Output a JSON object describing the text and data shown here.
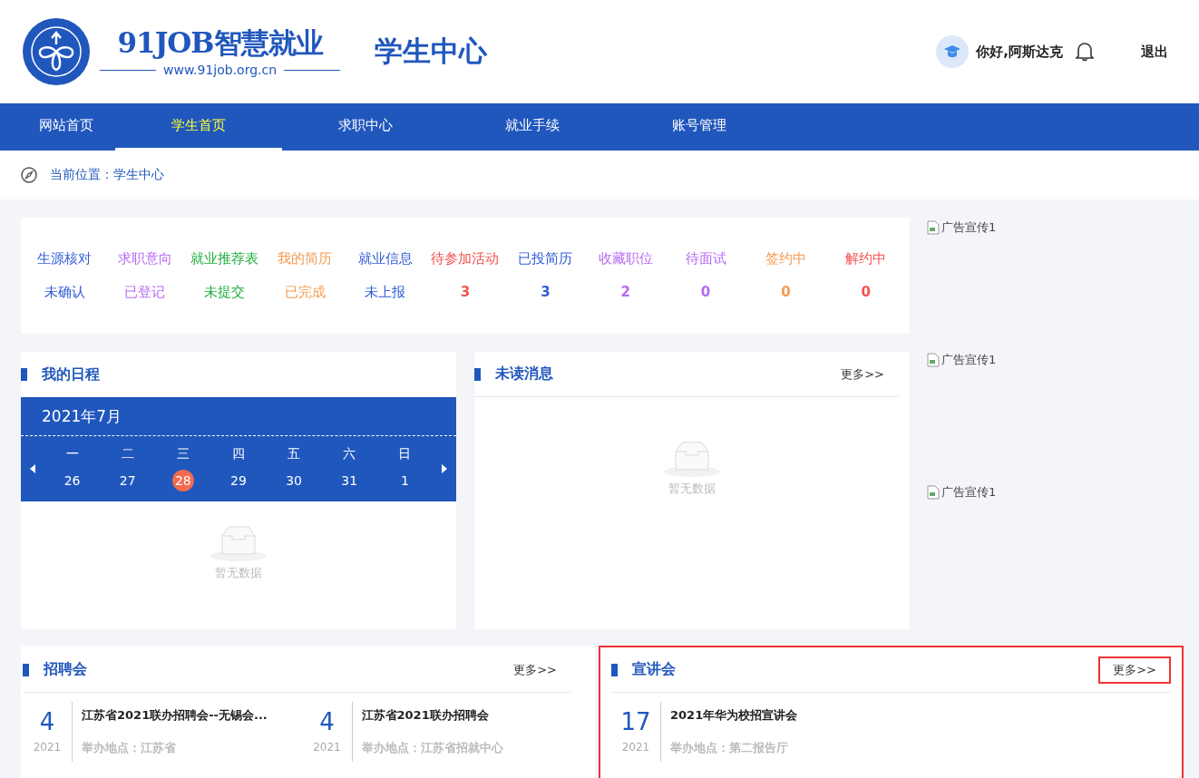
{
  "header": {
    "logo_title": "91JOB智慧就业",
    "logo_url": "www.91job.org.cn",
    "page_title": "学生中心",
    "greeting": "你好,阿斯达克",
    "logout": "退出"
  },
  "nav": [
    {
      "label": "网站首页",
      "selected": false
    },
    {
      "label": "学生首页",
      "selected": true
    },
    {
      "label": "求职中心",
      "selected": false
    },
    {
      "label": "就业手续",
      "selected": false
    },
    {
      "label": "账号管理",
      "selected": false
    }
  ],
  "breadcrumb": "当前位置：学生中心",
  "stats": [
    {
      "label": "生源核对",
      "value": "未确认",
      "color": "#2f5bd6"
    },
    {
      "label": "求职意向",
      "value": "已登记",
      "color": "#b769f2"
    },
    {
      "label": "就业推荐表",
      "value": "未提交",
      "color": "#1fae3c"
    },
    {
      "label": "我的简历",
      "value": "已完成",
      "color": "#f59a4f"
    },
    {
      "label": "就业信息",
      "value": "未上报",
      "color": "#2f5bd6"
    },
    {
      "label": "待参加活动",
      "value": "3",
      "color": "#f2524f"
    },
    {
      "label": "已投简历",
      "value": "3",
      "color": "#2f5bd6"
    },
    {
      "label": "收藏职位",
      "value": "2",
      "color": "#b769f2"
    },
    {
      "label": "待面试",
      "value": "0",
      "color": "#b769f2"
    },
    {
      "label": "签约中",
      "value": "0",
      "color": "#f59a4f"
    },
    {
      "label": "解约中",
      "value": "0",
      "color": "#f2524f"
    }
  ],
  "schedule": {
    "title": "我的日程",
    "month": "2021年7月",
    "weekdays": [
      "一",
      "二",
      "三",
      "四",
      "五",
      "六",
      "日"
    ],
    "days": [
      {
        "label": "26",
        "selected": false
      },
      {
        "label": "27",
        "selected": false
      },
      {
        "label": "28",
        "selected": true
      },
      {
        "label": "29",
        "selected": false
      },
      {
        "label": "30",
        "selected": false
      },
      {
        "label": "31",
        "selected": false
      },
      {
        "label": "1",
        "selected": false
      }
    ],
    "empty": "暂无数据"
  },
  "messages": {
    "title": "未读消息",
    "more": "更多>>",
    "empty": "暂无数据"
  },
  "ads": [
    {
      "alt": "广告宣传1"
    },
    {
      "alt": "广告宣传1"
    },
    {
      "alt": "广告宣传1"
    }
  ],
  "fairs": {
    "title": "招聘会",
    "more": "更多>>",
    "highlighted": false,
    "more_highlighted": false,
    "items": [
      {
        "day": "4",
        "year": "2021",
        "title": "江苏省2021联办招聘会--无锡会...",
        "place": "举办地点：江苏省"
      },
      {
        "day": "4",
        "year": "2021",
        "title": "江苏省2021联办招聘会",
        "place": "举办地点：江苏省招就中心"
      }
    ]
  },
  "talks": {
    "title": "宣讲会",
    "more": "更多>>",
    "highlighted": true,
    "more_highlighted": true,
    "items": [
      {
        "day": "17",
        "year": "2021",
        "title": "2021年华为校招宣讲会",
        "place": "举办地点：第二报告厅"
      }
    ]
  }
}
